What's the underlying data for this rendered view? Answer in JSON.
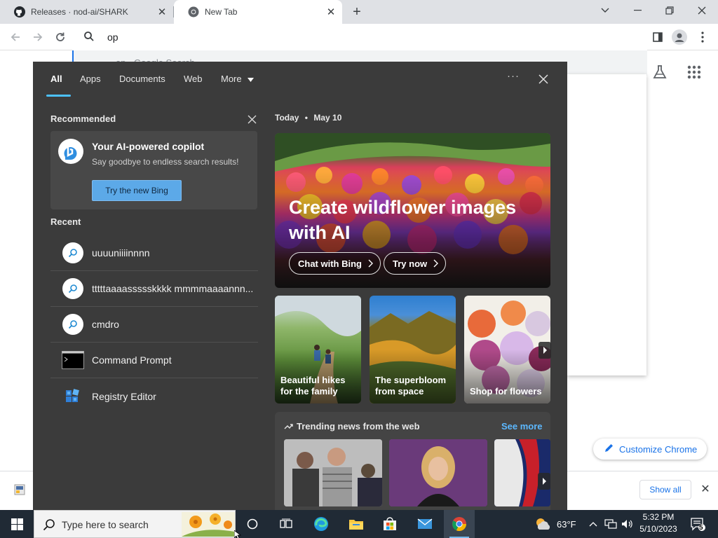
{
  "browser": {
    "tabs": [
      {
        "title": "Releases · nod-ai/SHARK",
        "icon": "github-icon",
        "active": false
      },
      {
        "title": "New Tab",
        "icon": "chrome-icon",
        "active": true
      }
    ],
    "new_tab_symbol": "+",
    "tab_close_symbol": "✕",
    "omnibox_query": "op",
    "omnibox_suggestion": "op - Google Search",
    "customize_label": "Customize Chrome",
    "download_show_all": "Show all",
    "download_close": "✕"
  },
  "search_panel": {
    "tabs": [
      {
        "label": "All",
        "active": true
      },
      {
        "label": "Apps"
      },
      {
        "label": "Documents"
      },
      {
        "label": "Web"
      },
      {
        "label": "More"
      }
    ],
    "more_dots": "···",
    "recommended": {
      "heading": "Recommended",
      "title": "Your AI-powered copilot",
      "subtitle": "Say goodbye to endless search results!",
      "button": "Try the new Bing"
    },
    "recent_heading": "Recent",
    "recent_items": [
      {
        "label": "uuuuniiiinnnn",
        "icon": "search-icon"
      },
      {
        "label": "tttttaaaassssskkkk mmmmaaaannn...",
        "icon": "search-icon"
      },
      {
        "label": "cmdro",
        "icon": "search-icon"
      },
      {
        "label": "Command Prompt",
        "icon": "terminal-icon"
      },
      {
        "label": "Registry Editor",
        "icon": "registry-icon"
      }
    ],
    "today": {
      "label": "Today",
      "separator": "•",
      "date": "May 10"
    },
    "hero": {
      "title": "Create wildflower images with AI",
      "buttons": [
        "Chat with Bing",
        "Try now"
      ]
    },
    "tiles": [
      {
        "caption": "Beautiful hikes for the family"
      },
      {
        "caption": "The superbloom from space"
      },
      {
        "caption": "Shop for flowers"
      }
    ],
    "trending": {
      "heading": "Trending news from the web",
      "see_more": "See more"
    }
  },
  "taskbar": {
    "search_placeholder": "Type here to search",
    "weather": "63°F",
    "time": "5:32 PM",
    "date": "5/10/2023",
    "notification_count": "5"
  }
}
